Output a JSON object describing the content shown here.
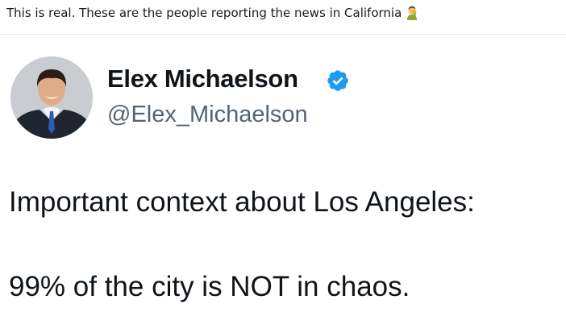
{
  "post": {
    "caption": "This is real. These are the people reporting the news in California",
    "caption_emoji": "man-facepalming-emoji"
  },
  "tweet": {
    "author": {
      "name": "Elex Michaelson",
      "handle": "@Elex_Michaelson",
      "verified": true
    },
    "text_lines": [
      "Important context about Los Angeles:",
      "99% of the city is NOT in chaos."
    ]
  },
  "colors": {
    "text_primary": "#0f1419",
    "text_secondary": "#536471",
    "verified_blue": "#1d9bf0",
    "divider": "#e7e7e7"
  }
}
